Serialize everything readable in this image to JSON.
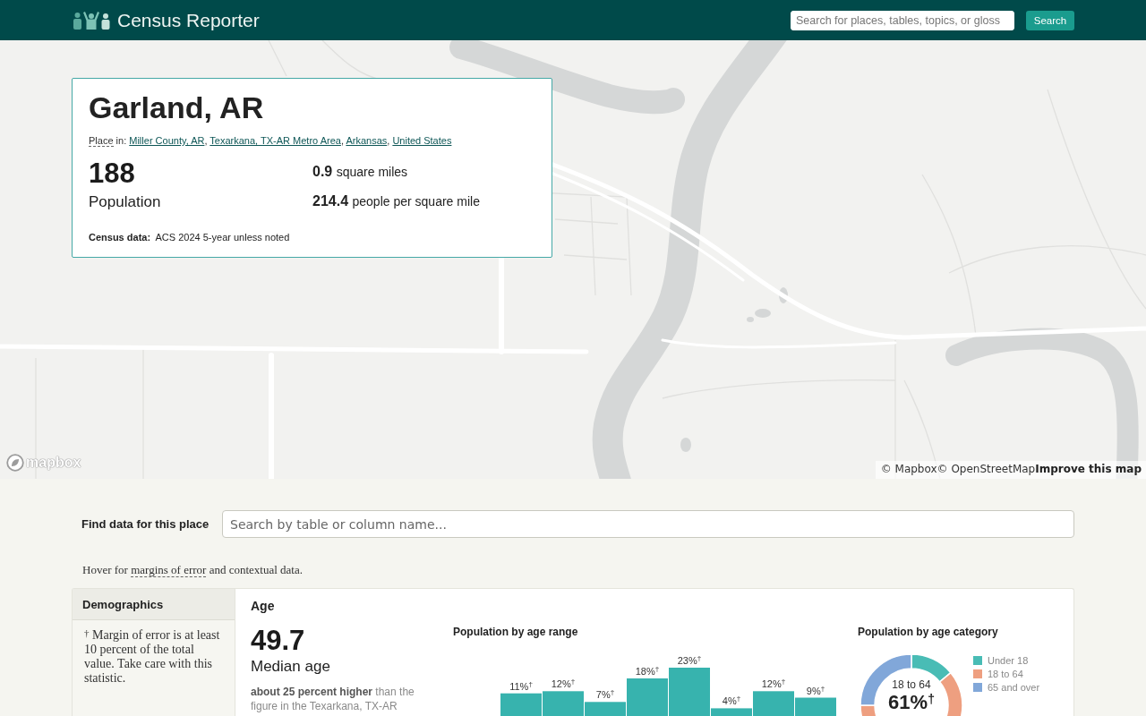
{
  "header": {
    "logo_text": "Census Reporter",
    "search": {
      "placeholder": "Search for places, tables, topics, or gloss"
    },
    "search_button": "Search"
  },
  "map": {
    "logo_text": "mapbox",
    "attribution": [
      {
        "text": "© Mapbox",
        "bold": false
      },
      {
        "text": "© OpenStreetMap",
        "bold": false
      },
      {
        "text": "Improve this map",
        "bold": true
      }
    ]
  },
  "place": {
    "title": "Garland, AR",
    "place_in": {
      "term": "Place",
      "text": "in:",
      "separator": ",",
      "links": [
        "Miller County, AR",
        "Texarkana, TX-AR Metro Area",
        "Arkansas",
        "United States"
      ]
    },
    "population": {
      "value": "188",
      "label": "Population"
    },
    "stats": [
      {
        "value": "0.9",
        "label": "square miles"
      },
      {
        "value": "214.4",
        "label": "people per square mile"
      }
    ],
    "census_data": "**Census data:** ACS 2024 5-year unless noted"
  },
  "find_data": {
    "label": "Find data for this place",
    "search": {
      "placeholder": "Search by table or column name..."
    }
  },
  "hover_note": {
    "before": "Hover for",
    "term": "margins of error",
    "after": "and contextual data."
  },
  "sidebar": {
    "title": "Demographics",
    "footnote": "$^{†}$ Margin of error is at least 10 percent of the total value. Take care with this statistic."
  },
  "age": {
    "title": "Age",
    "median": {
      "value": "49.7",
      "label": "Median age",
      "comparison": "**about 25 percent higher** than the figure in the Texarkana, TX-AR"
    },
    "range_chart": {
      "title": "Population by age range",
      "bar_labels": [
        "11%$^{†}$",
        "12%$^{†}$",
        "7%$^{†}$",
        "18%$^{†}$",
        "23%$^{†}$",
        "4%$^{†}$",
        "12%$^{†}$",
        "9%$^{†}$"
      ]
    },
    "category_chart": {
      "title": "Population by age category",
      "legend": [
        {
          "label": "Under 18",
          "color": "#49bcb5"
        },
        {
          "label": "18 to 64",
          "color": "#ee9f80"
        },
        {
          "label": "65 and over",
          "color": "#81a7d9"
        }
      ],
      "center_label": "18 to 64",
      "center_value": "61%$^{†}$"
    }
  }
}
